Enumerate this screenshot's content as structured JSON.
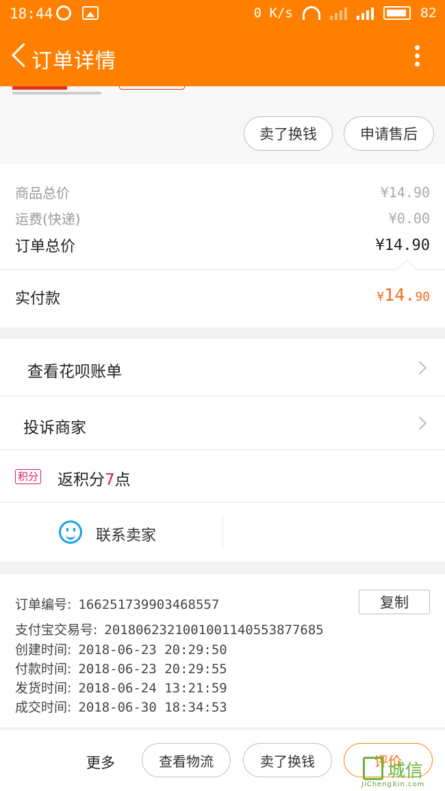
{
  "status_bar": {
    "time": "18:44",
    "net_speed": "0 K/s",
    "network": "4G",
    "battery": "82"
  },
  "header": {
    "title": "订单详情"
  },
  "top_actions": {
    "sell_label": "卖了换钱",
    "after_sale_label": "申请售后"
  },
  "prices": {
    "goods_total_label": "商品总价",
    "goods_total_value": "¥14.90",
    "shipping_label": "运费(快递)",
    "shipping_value": "¥0.00",
    "order_total_label": "订单总价",
    "order_total_value": "¥14.90",
    "paid_label": "实付款",
    "paid_currency": "¥",
    "paid_int": "14.",
    "paid_dec": "90"
  },
  "links": {
    "huabei": "查看花呗账单",
    "complain": "投诉商家"
  },
  "points": {
    "badge": "积分",
    "prefix": "返积分",
    "num": "7",
    "suffix": "点"
  },
  "contact": {
    "label": "联系卖家"
  },
  "order_info": {
    "copy_label": "复制",
    "rows": [
      {
        "label": "订单编号:",
        "value": "166251739903468557"
      },
      {
        "label": "支付宝交易号:",
        "value": "2018062321001001140553877685"
      },
      {
        "label": "创建时间:",
        "value": "2018-06-23 20:29:50"
      },
      {
        "label": "付款时间:",
        "value": "2018-06-23 20:29:55"
      },
      {
        "label": "发货时间:",
        "value": "2018-06-24 13:21:59"
      },
      {
        "label": "成交时间:",
        "value": "2018-06-30 18:34:53"
      }
    ]
  },
  "bottom": {
    "more": "更多",
    "logistics": "查看物流",
    "sell": "卖了换钱",
    "review": "评价"
  },
  "watermark": {
    "text": "城信",
    "sub": "JiChengXin.com"
  },
  "colors": {
    "brand": "#ff8000",
    "accent_price": "#f56c1d",
    "points": "#d81e5b",
    "contact_icon": "#1aa0e8"
  }
}
